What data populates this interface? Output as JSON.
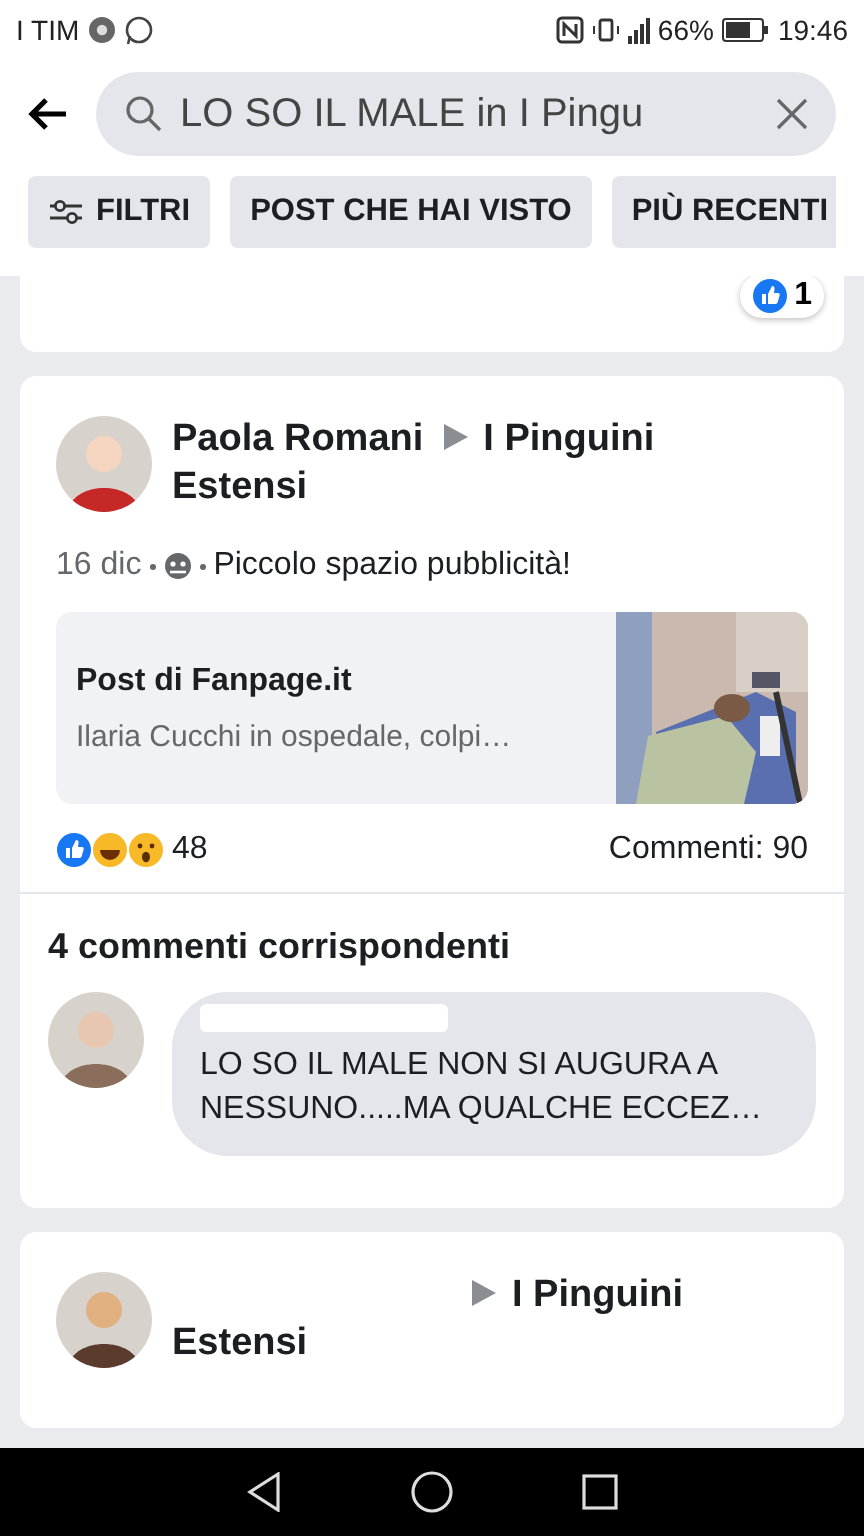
{
  "status_bar": {
    "carrier": "I TIM",
    "battery_percent": "66%",
    "time": "19:46"
  },
  "search": {
    "value": "LO SO IL MALE in I Pingu"
  },
  "filters": [
    {
      "label": "FILTRI",
      "kind": "filter"
    },
    {
      "label": "POST CHE HAI VISTO",
      "kind": "plain"
    },
    {
      "label": "PIÙ RECENTI",
      "kind": "plain"
    }
  ],
  "previous_post": {
    "reaction_count": "1"
  },
  "post": {
    "author": "Paola Romani",
    "group": "I Pinguini Estensi",
    "date": "16 dic",
    "text": "Piccolo spazio pubblicità!",
    "link": {
      "title": "Post di Fanpage.it",
      "description": "Ilaria Cucchi in ospedale, colpi…",
      "kind": "picture"
    },
    "reaction_count": "48",
    "comments": "Commenti: 90",
    "matching_heading": "4 commenti corrispondenti",
    "comment": {
      "text": "LO SO IL MALE NON SI AUGURA A NESSUNO.....MA QUALCHE ECCEZ…"
    }
  },
  "next_post": {
    "group": "I Pinguini Estensi"
  }
}
